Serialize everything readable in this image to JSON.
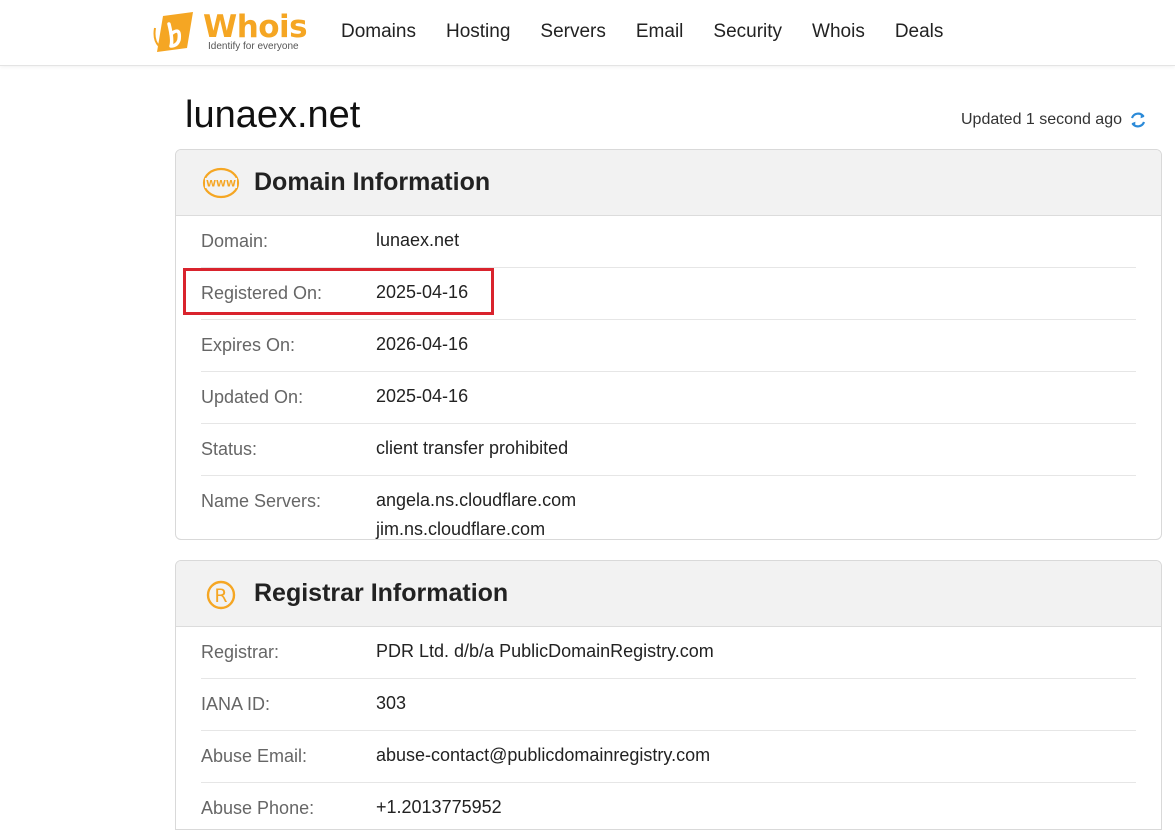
{
  "header": {
    "logo_text": "Whois",
    "logo_tagline": "Identify for everyone",
    "nav": [
      "Domains",
      "Hosting",
      "Servers",
      "Email",
      "Security",
      "Whois",
      "Deals"
    ]
  },
  "page": {
    "title": "lunaex.net",
    "updated": "Updated 1 second ago"
  },
  "domain_info": {
    "title": "Domain Information",
    "icon": "www-icon",
    "rows": [
      {
        "label": "Domain:",
        "value": "lunaex.net"
      },
      {
        "label": "Registered On:",
        "value": "2025-04-16"
      },
      {
        "label": "Expires On:",
        "value": "2026-04-16"
      },
      {
        "label": "Updated On:",
        "value": "2025-04-16"
      },
      {
        "label": "Status:",
        "value": "client transfer prohibited"
      },
      {
        "label": "Name Servers:",
        "values": [
          "angela.ns.cloudflare.com",
          "jim.ns.cloudflare.com"
        ]
      }
    ]
  },
  "registrar_info": {
    "title": "Registrar Information",
    "icon": "registered-icon",
    "rows": [
      {
        "label": "Registrar:",
        "value": "PDR Ltd. d/b/a PublicDomainRegistry.com"
      },
      {
        "label": "IANA ID:",
        "value": "303"
      },
      {
        "label": "Abuse Email:",
        "value": "abuse-contact@publicdomainregistry.com"
      },
      {
        "label": "Abuse Phone:",
        "value": "+1.2013775952"
      }
    ]
  },
  "colors": {
    "brand_orange": "#f5a623",
    "refresh_blue": "#2b8ad8",
    "highlight_red": "#d9232d"
  }
}
